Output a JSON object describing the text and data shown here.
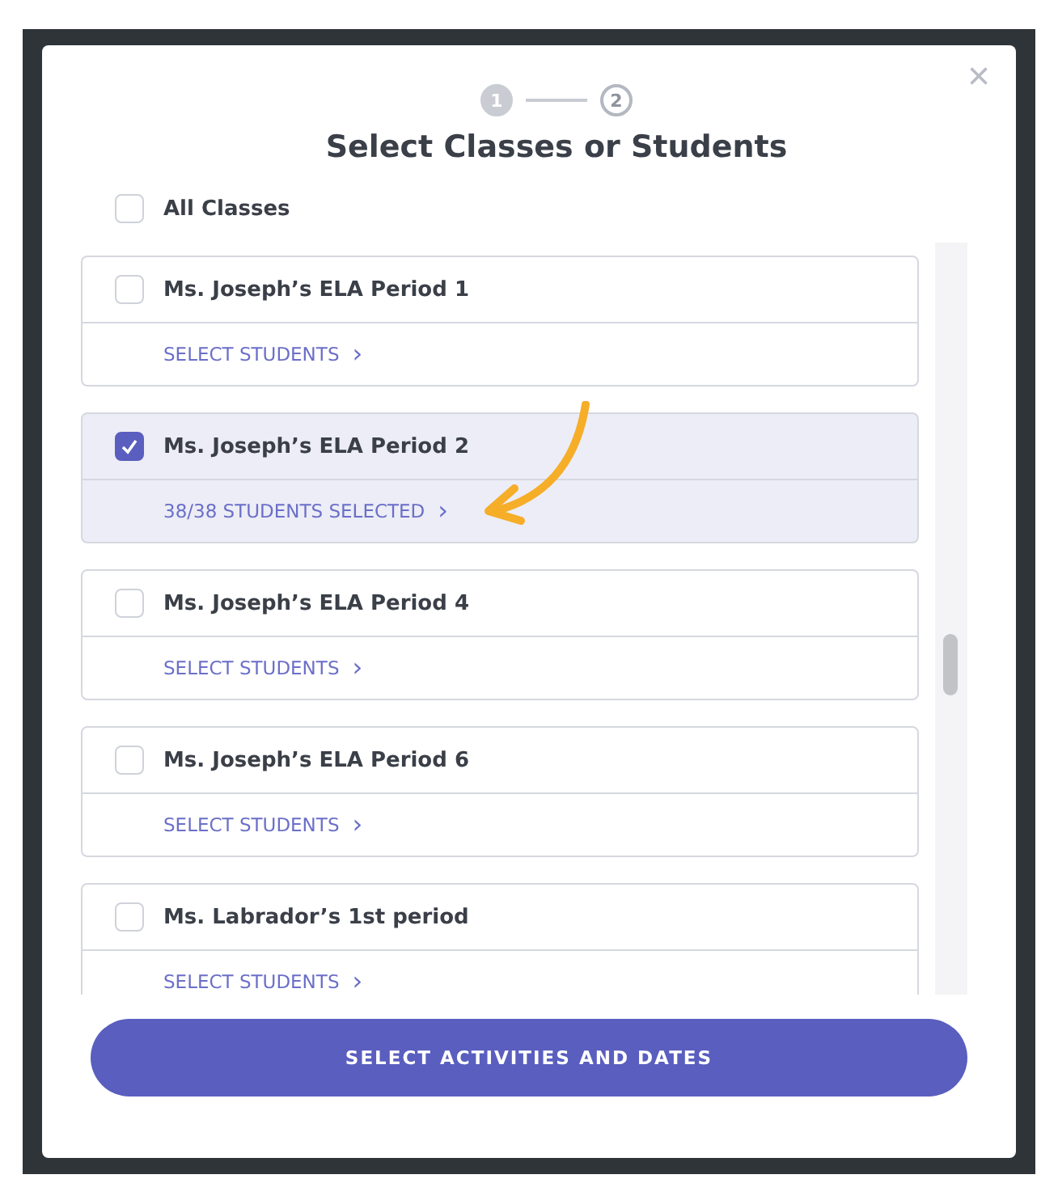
{
  "steps": [
    {
      "label": "1",
      "selected": true
    },
    {
      "label": "2",
      "selected": false
    }
  ],
  "title": "Select Classes or Students",
  "close": "×",
  "all_classes": {
    "label": "All Classes",
    "checked": false
  },
  "classes": [
    {
      "name": "Ms. Joseph’s ELA Period 1",
      "checked": false,
      "link": "SELECT STUDENTS",
      "chevron": "›"
    },
    {
      "name": "Ms. Joseph’s ELA Period 2",
      "checked": true,
      "link": "38/38 STUDENTS SELECTED",
      "chevron": "›"
    },
    {
      "name": "Ms. Joseph’s ELA Period 4",
      "checked": false,
      "link": "SELECT STUDENTS",
      "chevron": "›"
    },
    {
      "name": "Ms. Joseph’s ELA Period 6",
      "checked": false,
      "link": "SELECT STUDENTS",
      "chevron": "›"
    },
    {
      "name": "Ms. Labrador’s 1st period",
      "checked": false,
      "link": "SELECT STUDENTS",
      "chevron": "›"
    }
  ],
  "button": "SELECT ACTIVITIES AND DATES"
}
